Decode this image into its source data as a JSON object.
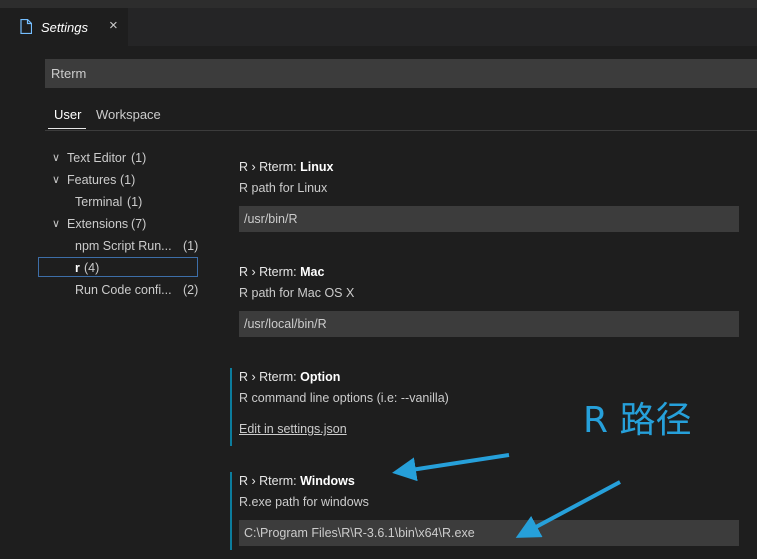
{
  "tab": {
    "title": "Settings",
    "icon": "file-icon",
    "close_label": "×"
  },
  "search": {
    "value": "Rterm"
  },
  "scopes": {
    "user": "User",
    "workspace": "Workspace"
  },
  "toc": [
    {
      "label": "Text Editor",
      "count": "(1)",
      "chevron": "∨"
    },
    {
      "label": "Features",
      "count": "(1)",
      "chevron": "∨"
    },
    {
      "label": "Terminal",
      "count": "(1)",
      "chevron": ""
    },
    {
      "label": "Extensions",
      "count": "(7)",
      "chevron": "∨"
    },
    {
      "label": "npm Script Run...",
      "count": "(1)",
      "chevron": ""
    },
    {
      "label": "r",
      "count": "(4)",
      "chevron": ""
    },
    {
      "label": "Run Code confi...",
      "count": "(2)",
      "chevron": ""
    }
  ],
  "settings": [
    {
      "prefix": "R › Rterm: ",
      "name": "Linux",
      "description": "R path for Linux",
      "value": "/usr/bin/R"
    },
    {
      "prefix": "R › Rterm: ",
      "name": "Mac",
      "description": "R path for Mac OS X",
      "value": "/usr/local/bin/R"
    },
    {
      "prefix": "R › Rterm: ",
      "name": "Option",
      "description": "R command line options (i.e: --vanilla)",
      "link": "Edit in settings.json"
    },
    {
      "prefix": "R › Rterm: ",
      "name": "Windows",
      "description": "R.exe path for windows",
      "value": "C:\\Program Files\\R\\R-3.6.1\\bin\\x64\\R.exe"
    }
  ],
  "annotation": {
    "text": "R 路径",
    "color": "#26a0da"
  },
  "colors": {
    "accent": "#0c7d9d",
    "background": "#1e1e1e",
    "input": "#3c3c3c"
  }
}
